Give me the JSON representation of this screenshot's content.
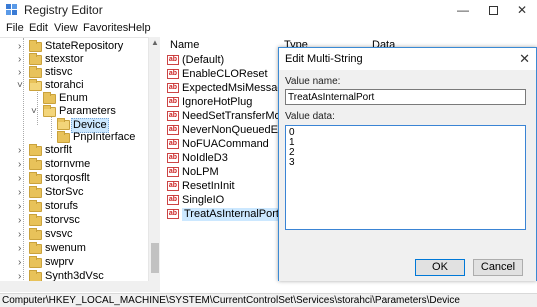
{
  "window": {
    "title": "Registry Editor",
    "minimize": "—",
    "close": "✕"
  },
  "menu": [
    "File",
    "Edit",
    "View",
    "Favorites",
    "Help"
  ],
  "tree": {
    "items": [
      {
        "label": "StateRepository",
        "open": false
      },
      {
        "label": "stexstor",
        "open": false
      },
      {
        "label": "stisvc",
        "open": false
      },
      {
        "label": "storahci",
        "open": true
      },
      {
        "label": "Enum",
        "open": false
      },
      {
        "label": "Parameters",
        "open": true
      },
      {
        "label": "Device",
        "open": false
      },
      {
        "label": "PnpInterface",
        "open": false
      },
      {
        "label": "storflt",
        "open": false
      },
      {
        "label": "stornvme",
        "open": false
      },
      {
        "label": "storqosflt",
        "open": false
      },
      {
        "label": "StorSvc",
        "open": false
      },
      {
        "label": "storufs",
        "open": false
      },
      {
        "label": "storvsc",
        "open": false
      },
      {
        "label": "svsvc",
        "open": false
      },
      {
        "label": "swenum",
        "open": false
      },
      {
        "label": "swprv",
        "open": false
      },
      {
        "label": "Synth3dVsc",
        "open": false
      }
    ]
  },
  "list": {
    "columns": [
      "Name",
      "Type",
      "Data"
    ],
    "rows": [
      "(Default)",
      "EnableCLOReset",
      "ExpectedMsiMessage...",
      "IgnoreHotPlug",
      "NeedSetTransferMode...",
      "NeverNonQueuedErro...",
      "NoFUACommand",
      "NoIdleD3",
      "NoLPM",
      "ResetInInit",
      "SingleIO",
      "TreatAsInternalPort"
    ],
    "value_icon": "ab"
  },
  "dialog": {
    "title": "Edit Multi-String",
    "value_name_label": "Value name:",
    "value_name": "TreatAsInternalPort",
    "value_data_label": "Value data:",
    "value_data": [
      "0",
      "1",
      "2",
      "3"
    ],
    "ok": "OK",
    "cancel": "Cancel",
    "close": "✕"
  },
  "status": "Computer\\HKEY_LOCAL_MACHINE\\SYSTEM\\CurrentControlSet\\Services\\storahci\\Parameters\\Device",
  "colors": {
    "accent": "#0078d7",
    "selection": "#cce8ff",
    "folder": "#e8c25a"
  }
}
